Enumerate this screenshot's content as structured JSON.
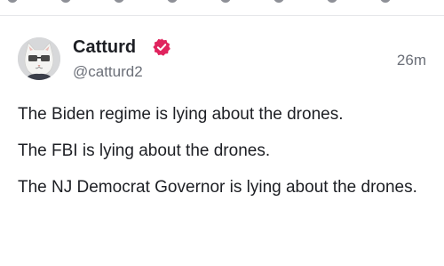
{
  "post": {
    "author": {
      "display_name": "Catturd",
      "handle": "@catturd2",
      "verified": true,
      "avatar_icon": "cat-with-glasses-avatar"
    },
    "timestamp": "26m",
    "paragraphs": [
      "The Biden regime is lying about the drones.",
      "The FBI is lying about the drones.",
      "The NJ Democrat Governor is lying about the drones."
    ]
  },
  "colors": {
    "verified_badge": "#e0245e",
    "text_primary": "#1d1f24",
    "text_secondary": "#6b6f78",
    "divider": "#e6e7ea"
  }
}
